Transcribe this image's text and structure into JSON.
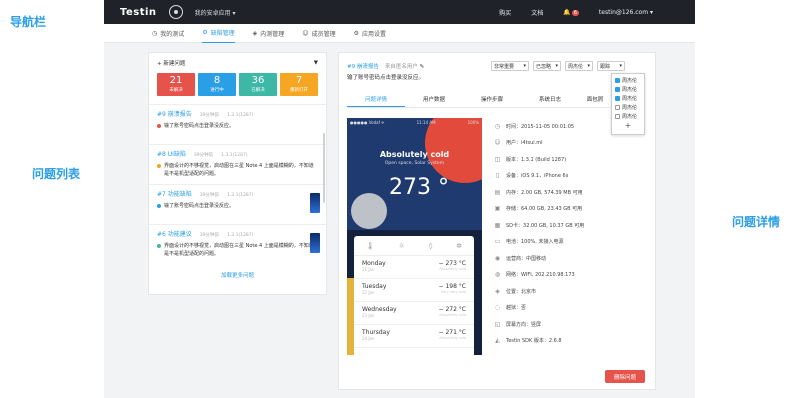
{
  "callouts": {
    "nav": "导航栏",
    "issue_list": "问题列表",
    "issue_detail": "问题详情"
  },
  "topbar": {
    "logo": "Testin",
    "app_select": "我的安卓应用 ▾",
    "buy": "购买",
    "docs": "文档",
    "notif_count": "6",
    "user": "testin@126.com ▾"
  },
  "subnav": {
    "tabs": [
      {
        "label": "我的测试",
        "icon": "◷"
      },
      {
        "label": "缺陷管理",
        "icon": "⚙"
      },
      {
        "label": "内测管理",
        "icon": "◈"
      },
      {
        "label": "成员管理",
        "icon": "☺"
      },
      {
        "label": "应用设置",
        "icon": "⚙"
      }
    ]
  },
  "issue_list": {
    "new_issue": "+ 新建问题",
    "stats": [
      {
        "num": "21",
        "label": "未解决",
        "color": "#e5534b"
      },
      {
        "num": "8",
        "label": "进行中",
        "color": "#2b9fe6"
      },
      {
        "num": "36",
        "label": "已解决",
        "color": "#3db8a6"
      },
      {
        "num": "7",
        "label": "重新打开",
        "color": "#f5a623"
      }
    ],
    "items": [
      {
        "title": "#9 崩溃报告",
        "time": "39分钟前",
        "version": "1.3.1(1287)",
        "desc": "输了账号密码点击登录没反应。",
        "dot": "#e5534b"
      },
      {
        "title": "#8 UI缺陷",
        "time": "39分钟前",
        "version": "1.3.1(1287)",
        "desc": "界面设计的不够视觉，启动图在三星 Note 4 上面是模糊的，不知道是不是机型适配的问题。",
        "dot": "#f5a623"
      },
      {
        "title": "#7 功能缺陷",
        "time": "39分钟前",
        "version": "1.3.1(1287)",
        "desc": "输了账号密码点击登录没反应。",
        "dot": "#2b9fe6"
      },
      {
        "title": "#6 功能建议",
        "time": "39分钟前",
        "version": "1.3.1(1287)",
        "desc": "界面设计的不够视觉，启动图在三星 Note 4 上面是模糊的，不知道是不是机型适配的问题。",
        "dot": "#3db8a6"
      }
    ],
    "load_more": "加载更多问题"
  },
  "detail": {
    "id": "#9 崩溃报告",
    "from": "来自匿名用户",
    "summary": "输了账号密码点击登录没反应。",
    "selects": [
      {
        "label": "非常重要"
      },
      {
        "label": "已忽略"
      },
      {
        "label": "周杰伦"
      },
      {
        "label": "跟踪"
      }
    ],
    "follower_options": [
      {
        "name": "周杰伦",
        "checked": true
      },
      {
        "name": "周杰伦",
        "checked": true
      },
      {
        "name": "周杰伦",
        "checked": true
      },
      {
        "name": "周杰伦",
        "checked": false
      },
      {
        "name": "周杰伦",
        "checked": false
      }
    ],
    "tabs": [
      "问题详情",
      "用户数据",
      "操作步骤",
      "系统日志",
      "面包屑"
    ],
    "info": [
      {
        "icon": "◷",
        "text": "时间：2015-11-05 00:01:05"
      },
      {
        "icon": "☺",
        "text": "用户：i4tsui.ml"
      },
      {
        "icon": "◫",
        "text": "版本：1.3.1 (Build 1287)"
      },
      {
        "icon": "▯",
        "text": "设备：iOS 9.1，iPhone 6s"
      },
      {
        "icon": "▤",
        "text": "内存：2.00 GB, 574.39 MB 可用"
      },
      {
        "icon": "▣",
        "text": "存储：64.00 GB, 23.43 GB 可用"
      },
      {
        "icon": "▦",
        "text": "SD卡：32.00 GB, 10.37 GB 可用"
      },
      {
        "icon": "▭",
        "text": "电池：100%, 未接入电源"
      },
      {
        "icon": "◉",
        "text": "运营商：中国移动"
      },
      {
        "icon": "◍",
        "text": "网络：WIFI, 202.210.98.173"
      },
      {
        "icon": "◈",
        "text": "位置：北京市"
      },
      {
        "icon": "◌",
        "text": "越狱：否"
      },
      {
        "icon": "◱",
        "text": "屏幕方向：竖屏"
      },
      {
        "icon": "◭",
        "text": "Testin SDK 版本：2.6.8"
      }
    ],
    "delete_label": "删除问题"
  },
  "screenshot": {
    "carrier": "●●●●● Vodaf ✈",
    "clock": "11:14 AM",
    "battery": "100%",
    "title": "Absolutely cold",
    "subtitle": "Open space, Solar System",
    "temp": "273 °",
    "forecast": [
      {
        "day": "Monday",
        "date": "21 Jan",
        "temp": "− 273 °C",
        "src": "Absolutely cold"
      },
      {
        "day": "Tuesday",
        "date": "22 Jan",
        "temp": "− 198 °C",
        "src": "Very very cold"
      },
      {
        "day": "Wednesday",
        "date": "23 Jan",
        "temp": "− 272 °C",
        "src": "Absolutely cold"
      },
      {
        "day": "Thursday",
        "date": "24 Jan",
        "temp": "− 271 °C",
        "src": "Absolutely cold"
      }
    ]
  }
}
